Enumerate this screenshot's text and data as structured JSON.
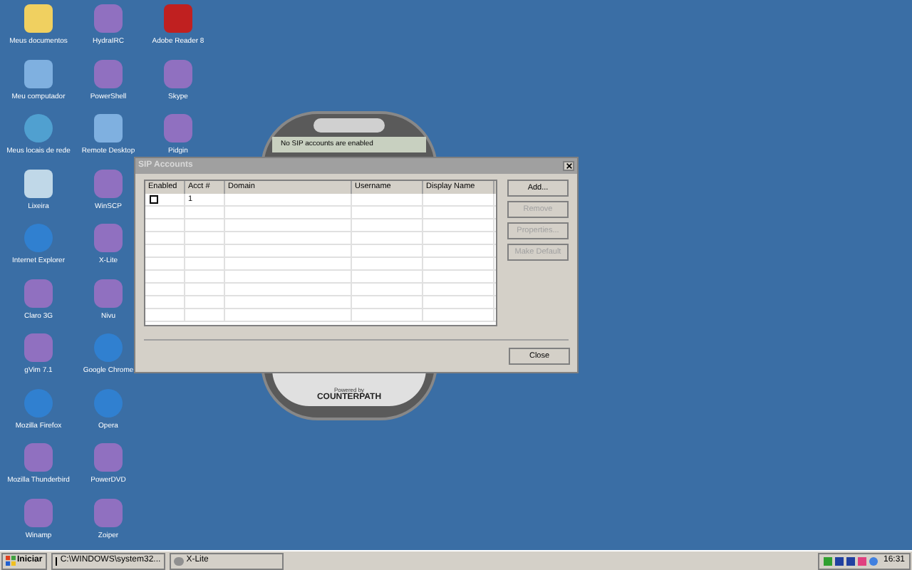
{
  "desktop_icons": [
    {
      "label": "Meus documentos",
      "kind": "folder"
    },
    {
      "label": "Meu computador",
      "kind": "computer"
    },
    {
      "label": "Meus locais de rede",
      "kind": "network"
    },
    {
      "label": "Lixeira",
      "kind": "trash"
    },
    {
      "label": "Internet Explorer",
      "kind": "globe"
    },
    {
      "label": "Claro 3G",
      "kind": "app"
    },
    {
      "label": "gVim 7.1",
      "kind": "app"
    },
    {
      "label": "Mozilla Firefox",
      "kind": "globe"
    },
    {
      "label": "Mozilla Thunderbird",
      "kind": "app"
    },
    {
      "label": "Winamp",
      "kind": "app"
    },
    {
      "label": "HydraIRC",
      "kind": "app"
    },
    {
      "label": "PowerShell",
      "kind": "app"
    },
    {
      "label": "Remote Desktop",
      "kind": "computer"
    },
    {
      "label": "WinSCP",
      "kind": "app"
    },
    {
      "label": "X-Lite",
      "kind": "app"
    },
    {
      "label": "Nivu",
      "kind": "app"
    },
    {
      "label": "Google Chrome",
      "kind": "globe"
    },
    {
      "label": "Opera",
      "kind": "globe"
    },
    {
      "label": "PowerDVD",
      "kind": "app"
    },
    {
      "label": "Zoiper",
      "kind": "app"
    },
    {
      "label": "Adobe Reader 8",
      "kind": "document"
    },
    {
      "label": "Skype",
      "kind": "app"
    },
    {
      "label": "Pidgin",
      "kind": "app"
    }
  ],
  "phone": {
    "status": "No SIP accounts are enabled",
    "brand_line": "Powered by",
    "brand": "COUNTERPATH"
  },
  "dialog": {
    "title": "SIP Accounts",
    "columns": [
      "Enabled",
      "Acct #",
      "Domain",
      "Username",
      "Display Name"
    ],
    "rows": [
      {
        "enabled": false,
        "acct": "1"
      }
    ],
    "buttons": [
      {
        "label": "Add...",
        "disabled": false
      },
      {
        "label": "Remove",
        "disabled": true
      },
      {
        "label": "Properties...",
        "disabled": true
      },
      {
        "label": "Make Default",
        "disabled": true
      }
    ],
    "close": "Close"
  },
  "taskbar": {
    "start": "Iniciar",
    "tasks": [
      {
        "label": "C:\\WINDOWS\\system32...",
        "kind": "console",
        "selected": false
      },
      {
        "label": "X-Lite",
        "kind": "phone",
        "selected": false
      }
    ],
    "clock": "16:31"
  }
}
